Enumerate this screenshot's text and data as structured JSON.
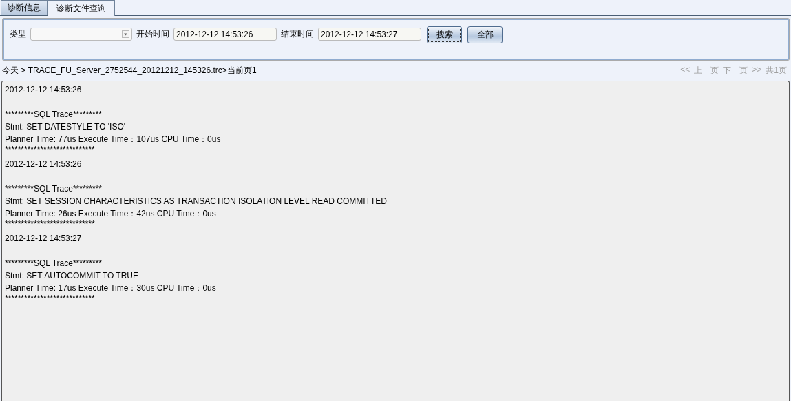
{
  "tabs": [
    {
      "label": "诊断信息",
      "selected": false
    },
    {
      "label": "诊断文件查询",
      "selected": true
    }
  ],
  "filter": {
    "type_label": "类型",
    "start_label": "开始时间",
    "start_value": "2012-12-12 14:53:26",
    "end_label": "结束时间",
    "end_value": "2012-12-12 14:53:27",
    "buttons": [
      {
        "label": "搜索",
        "focused": true
      },
      {
        "label": "全部",
        "focused": false
      }
    ]
  },
  "breadcrumb": "今天 > TRACE_FU_Server_2752544_20121212_145326.trc>当前页1",
  "pager": [
    {
      "label": "<<",
      "disabled": true
    },
    {
      "label": "上一页",
      "disabled": true
    },
    {
      "label": "下一页",
      "disabled": true
    },
    {
      "label": ">>",
      "disabled": true
    },
    {
      "label": "共1页",
      "disabled": true
    }
  ],
  "log": [
    {
      "timestamp": "2012-12-12 14:53:26",
      "header": "*********SQL Trace*********",
      "stmt": "Stmt: SET DATESTYLE TO 'ISO'",
      "timing": "Planner Time: 77us Execute Time：107us CPU Time：0us",
      "separator": "****************************"
    },
    {
      "timestamp": "2012-12-12 14:53:26",
      "header": "*********SQL Trace*********",
      "stmt": "Stmt: SET SESSION CHARACTERISTICS AS TRANSACTION ISOLATION LEVEL READ COMMITTED",
      "timing": "Planner Time: 26us Execute Time：42us CPU Time：0us",
      "separator": "****************************"
    },
    {
      "timestamp": "2012-12-12 14:53:27",
      "header": "*********SQL Trace*********",
      "stmt": "Stmt: SET AUTOCOMMIT TO TRUE",
      "timing": "Planner Time: 17us Execute Time：30us CPU Time：0us",
      "separator": "****************************"
    }
  ]
}
